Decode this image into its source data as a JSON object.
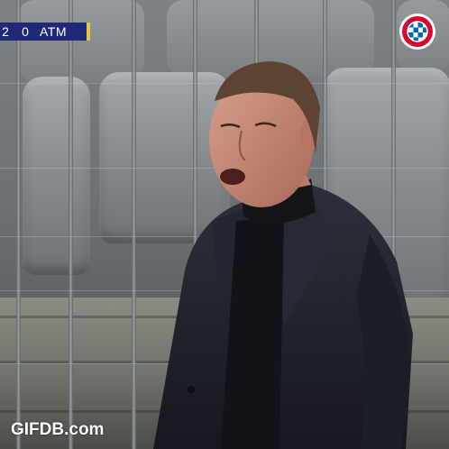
{
  "scoreboard": {
    "home_score": "2",
    "away_score": "0",
    "away_team": "ATM",
    "bar_color": "#1e2a78",
    "accent_color": "#e8c53a"
  },
  "club_logo": {
    "icon": "fc-bayern-munchen-logo",
    "text": "FC BAYERN MÜNCHEN",
    "colors": [
      "#dc052d",
      "#0066b2",
      "#ffffff"
    ]
  },
  "watermark": {
    "text": "GIFDB.com"
  }
}
